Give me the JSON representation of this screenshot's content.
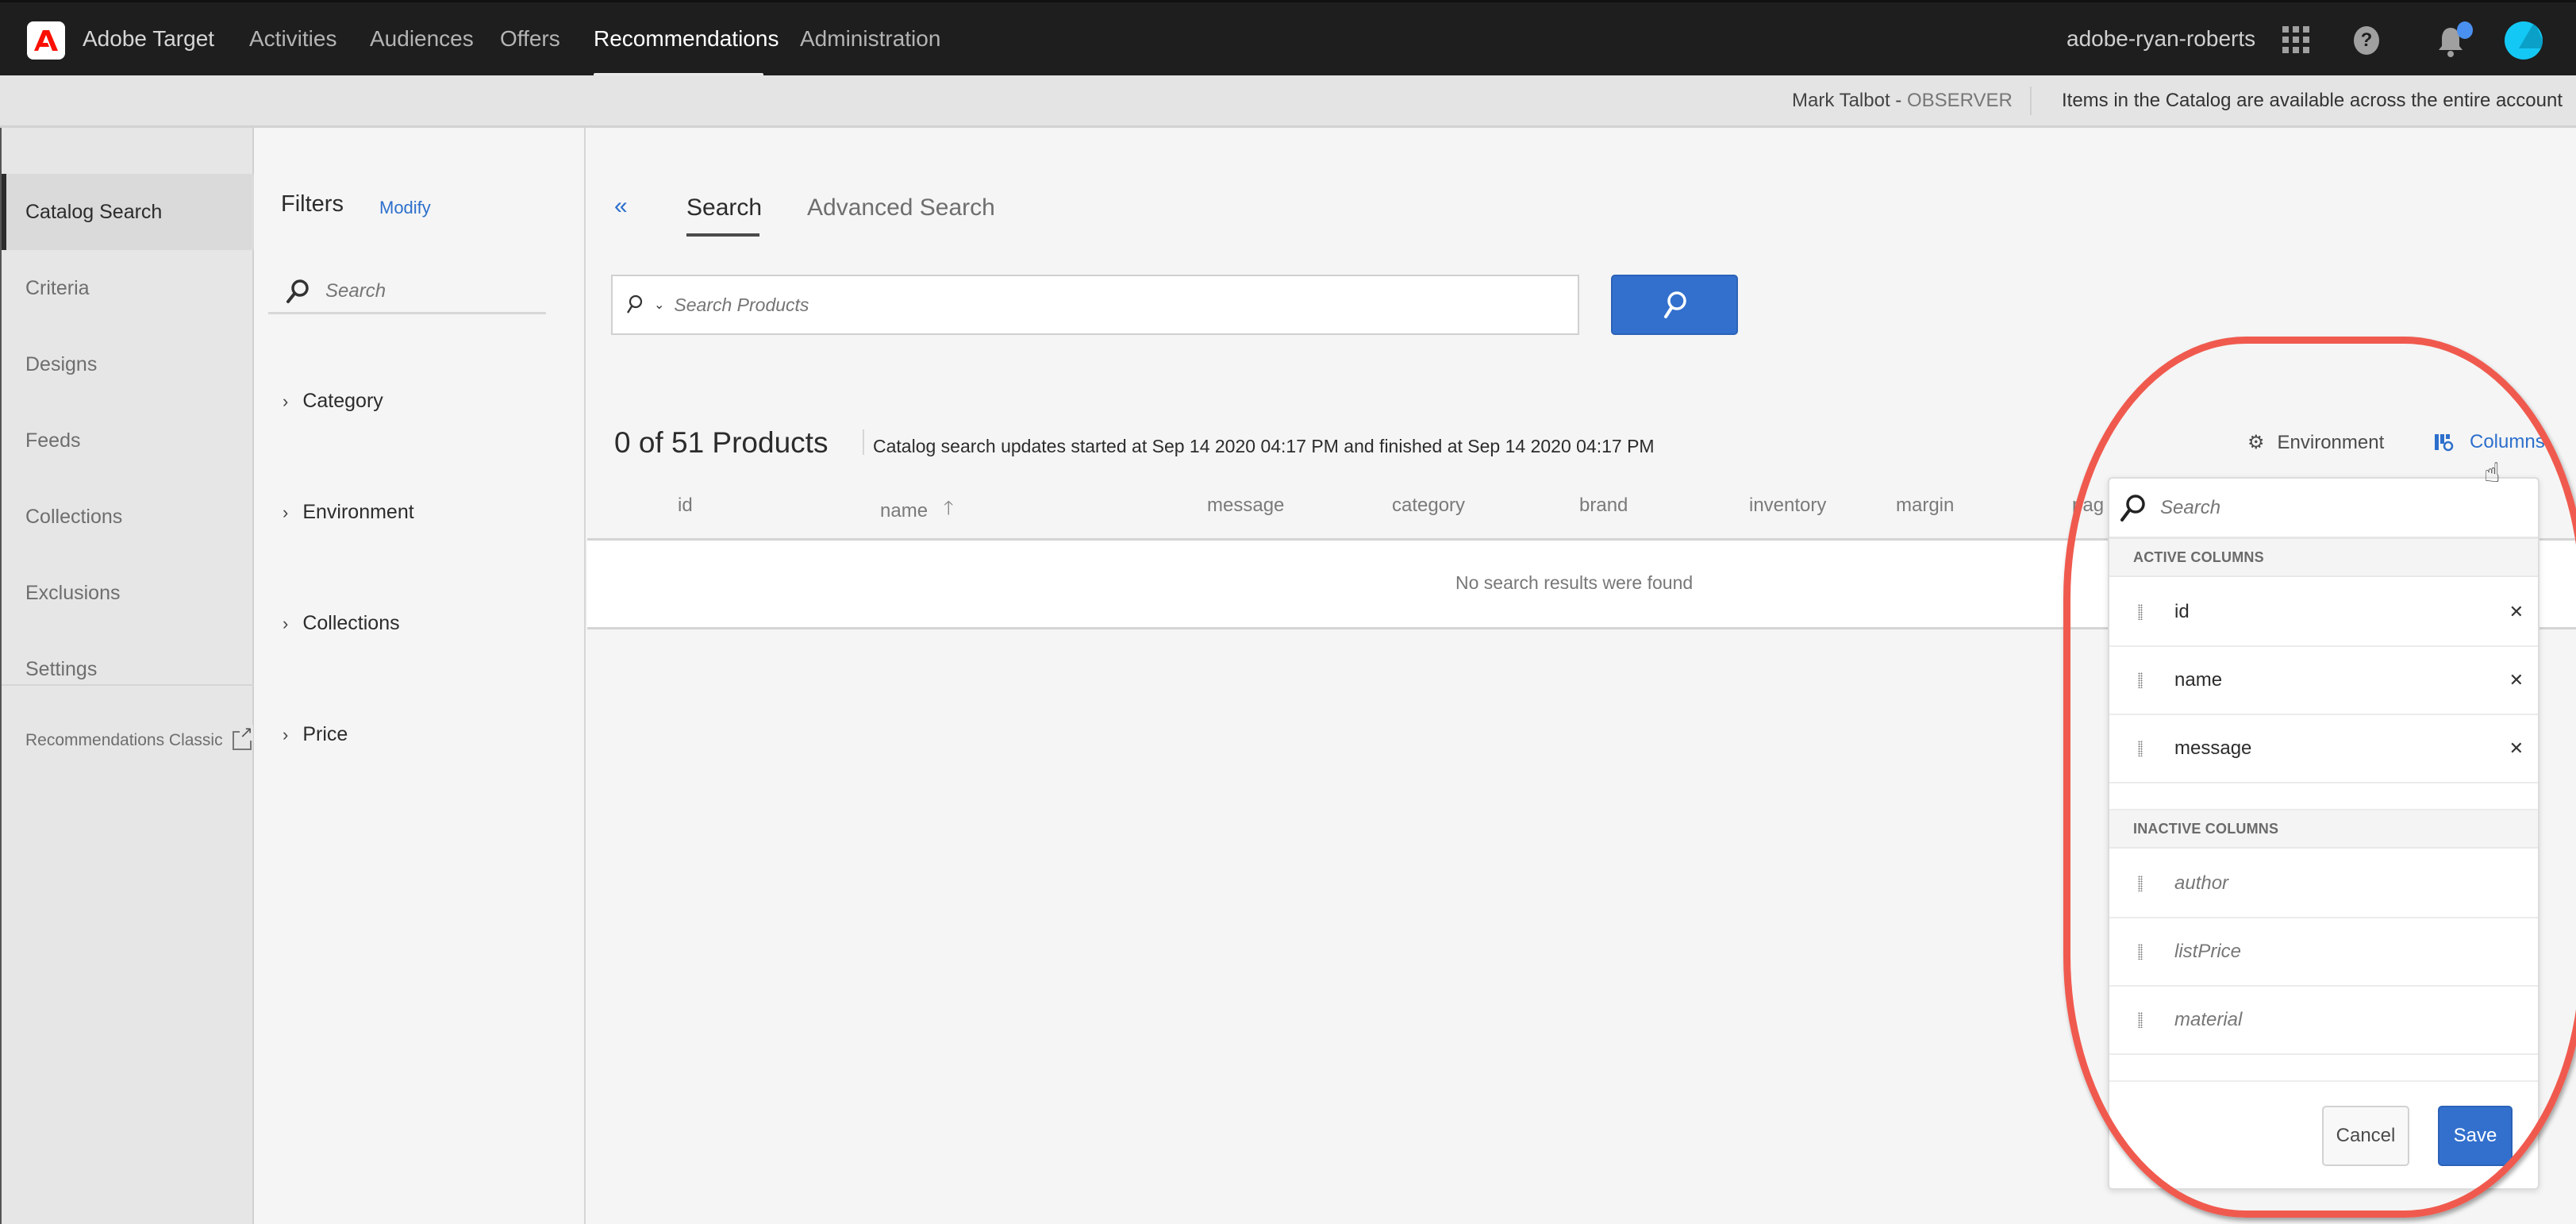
{
  "topnav": {
    "app_title": "Adobe Target",
    "items": [
      {
        "label": "Activities",
        "active": false
      },
      {
        "label": "Audiences",
        "active": false
      },
      {
        "label": "Offers",
        "active": false
      },
      {
        "label": "Recommendations",
        "active": true
      },
      {
        "label": "Administration",
        "active": false
      }
    ],
    "account_name": "adobe-ryan-roberts",
    "icons": [
      "apps-grid-icon",
      "help-icon",
      "notifications-bell-icon",
      "user-avatar"
    ],
    "brand_color": "#fa0f00",
    "notification_dot_color": "#4a90f0"
  },
  "subheader": {
    "user": "Mark Talbot",
    "separator": " - ",
    "role": "OBSERVER",
    "note": "Items in the Catalog are available across the entire account"
  },
  "sidebar": {
    "items": [
      {
        "label": "Catalog Search",
        "active": true
      },
      {
        "label": "Criteria",
        "active": false
      },
      {
        "label": "Designs",
        "active": false
      },
      {
        "label": "Feeds",
        "active": false
      },
      {
        "label": "Collections",
        "active": false
      },
      {
        "label": "Exclusions",
        "active": false
      },
      {
        "label": "Settings",
        "active": false
      }
    ],
    "classic_link": "Recommendations Classic"
  },
  "filters": {
    "title": "Filters",
    "modify_label": "Modify",
    "search_placeholder": "Search",
    "groups": [
      "Category",
      "Environment",
      "Collections",
      "Price"
    ]
  },
  "main": {
    "tabs": [
      {
        "label": "Search",
        "active": true
      },
      {
        "label": "Advanced Search",
        "active": false
      }
    ],
    "search_placeholder": "Search Products",
    "search_value": "",
    "result_count": "0 of 51 Products",
    "status": "Catalog search updates started at Sep 14 2020 04:17 PM and finished at Sep 14 2020 04:17 PM",
    "environment_label": "Environment",
    "columns_label": "Columns",
    "table": {
      "headers": [
        "id",
        "name",
        "message",
        "category",
        "brand",
        "inventory",
        "margin",
        "pag"
      ],
      "sorted_column": "name",
      "sort_direction": "ascending",
      "empty_message": "No search results were found"
    },
    "accent_color": "#3370cd"
  },
  "columns_popover": {
    "search_placeholder": "Search",
    "active_heading": "ACTIVE COLUMNS",
    "active_columns": [
      "id",
      "name",
      "message"
    ],
    "inactive_heading": "INACTIVE COLUMNS",
    "inactive_columns": [
      "author",
      "listPrice",
      "material"
    ],
    "cancel_label": "Cancel",
    "save_label": "Save",
    "highlight_color": "#f05a4e"
  }
}
